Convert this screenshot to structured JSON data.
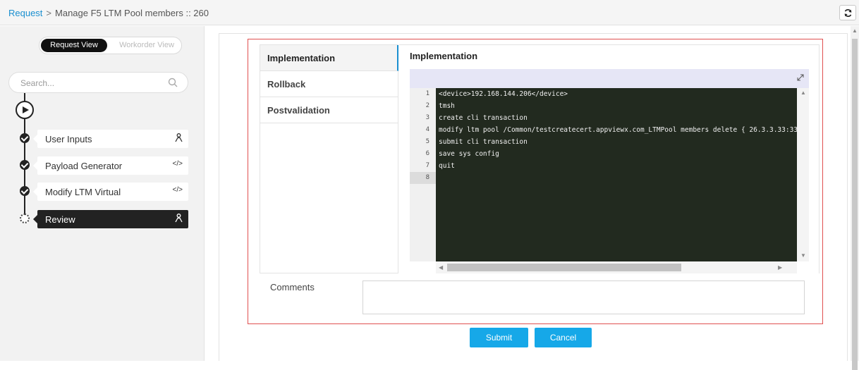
{
  "breadcrumb": {
    "link": "Request",
    "separator": ">",
    "current": "Manage F5 LTM Pool members :: 260"
  },
  "view_toggle": {
    "active": "Request View",
    "inactive": "Workorder View"
  },
  "search": {
    "placeholder": "Search..."
  },
  "workflow": {
    "steps": [
      {
        "label": "User Inputs",
        "icon": "user-icon",
        "icon_glyph": "A"
      },
      {
        "label": "Payload Generator",
        "icon": "code-icon",
        "icon_glyph": "</>"
      },
      {
        "label": "Modify LTM Virtual",
        "icon": "code-icon",
        "icon_glyph": "</>"
      },
      {
        "label": "Review",
        "icon": "user-icon",
        "icon_glyph": "A"
      }
    ]
  },
  "tabs": [
    "Implementation",
    "Rollback",
    "Postvalidation"
  ],
  "panel": {
    "title": "Implementation"
  },
  "editor": {
    "line_numbers": [
      "1",
      "2",
      "3",
      "4",
      "5",
      "6",
      "7",
      "8"
    ],
    "lines": [
      "<device>192.168.144.206</device>",
      "tmsh",
      "create cli transaction",
      "modify ltm pool /Common/testcreatecert.appviewx.com_LTMPool members delete { 26.3.3.33:33",
      "submit cli transaction",
      "save sys config",
      "quit",
      ""
    ]
  },
  "comments": {
    "label": "Comments",
    "value": ""
  },
  "buttons": {
    "submit": "Submit",
    "cancel": "Cancel"
  }
}
